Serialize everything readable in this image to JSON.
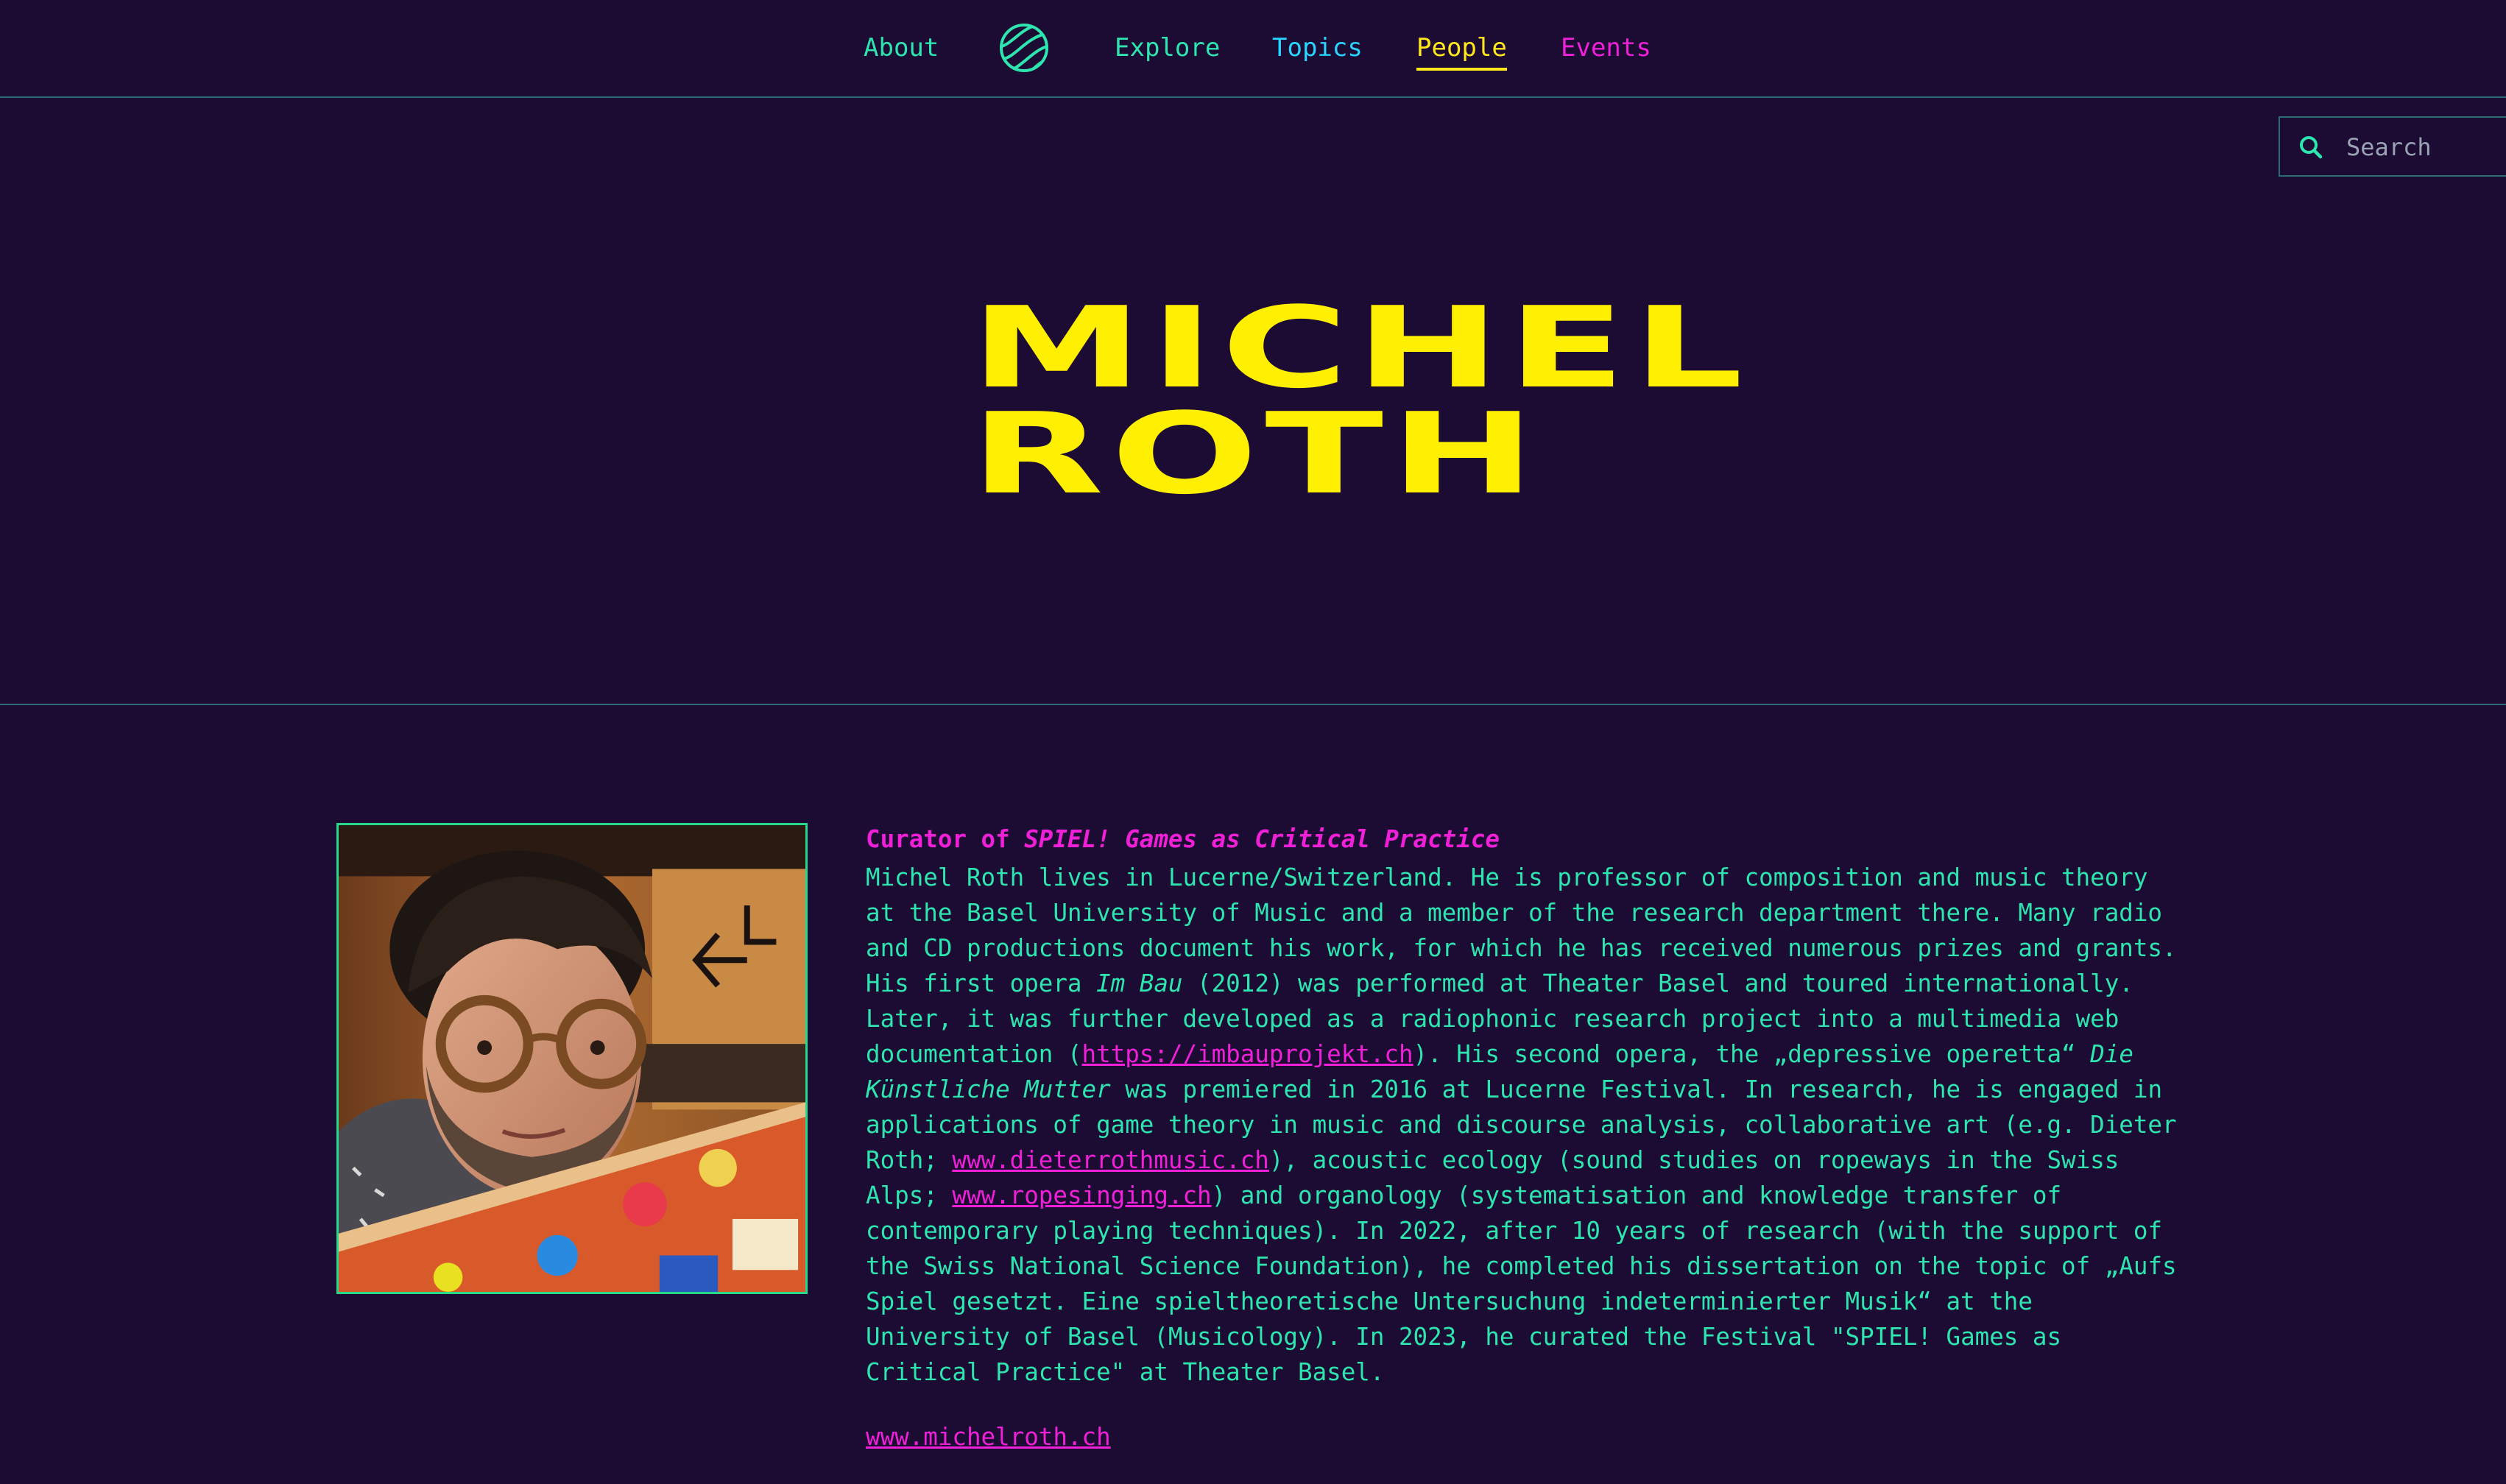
{
  "nav": {
    "about": "About",
    "explore": "Explore",
    "topics": "Topics",
    "people": "People",
    "events": "Events",
    "logo_icon": "globe-logo-icon"
  },
  "search": {
    "placeholder": "Search",
    "icon": "search-icon"
  },
  "hero": {
    "title_line1": "Michel",
    "title_line2": "Roth"
  },
  "profile": {
    "role_prefix": "Curator of ",
    "role_title": "SPIEL! Games as Critical Practice",
    "bio": {
      "t1": "Michel Roth lives in Lucerne/Switzerland. He is professor of composition and music theory at the Basel University of Music and a member of the research department there. Many radio and CD productions document his work, for which he has received numerous prizes and grants. His first opera ",
      "opera1": "Im Bau",
      "t2": " (2012) was performed at Theater Basel and toured internationally. Later, it was further developed as a radiophonic research project into a multimedia web documentation (",
      "link1": "https://imbauprojekt.ch",
      "t3": "). His second opera, the „depressive operetta“ ",
      "opera2": "Die Künstliche Mutter",
      "t4": " was premiered in 2016 at Lucerne Festival. In research, he is engaged in applications of game theory in music and discourse analysis, collaborative art (e.g. Dieter Roth; ",
      "link2": "www.dieterrothmusic.ch",
      "t5": "), acoustic ecology (sound studies on ropeways in the Swiss Alps; ",
      "link3": "www.ropesinging.ch",
      "t6": ") and organology (systematisation and knowledge transfer of contemporary playing techniques). In 2022, after 10 years of research (with the support of the Swiss National Science Foundation), he completed his dissertation on the topic of „Aufs Spiel gesetzt. Eine spieltheoretische Untersuchung indeterminierter Musik“ at the University of Basel (Musicology). In 2023, he curated the Festival \"SPIEL! Games as Critical Practice\" at Theater Basel."
    },
    "website": "www.michelroth.ch"
  },
  "colors": {
    "background": "#1c0b32",
    "text_green": "#2ee5b0",
    "magenta": "#f01fd8",
    "yellow": "#ffef00",
    "cyan": "#2ad4ff",
    "divider": "#2b6b72"
  }
}
